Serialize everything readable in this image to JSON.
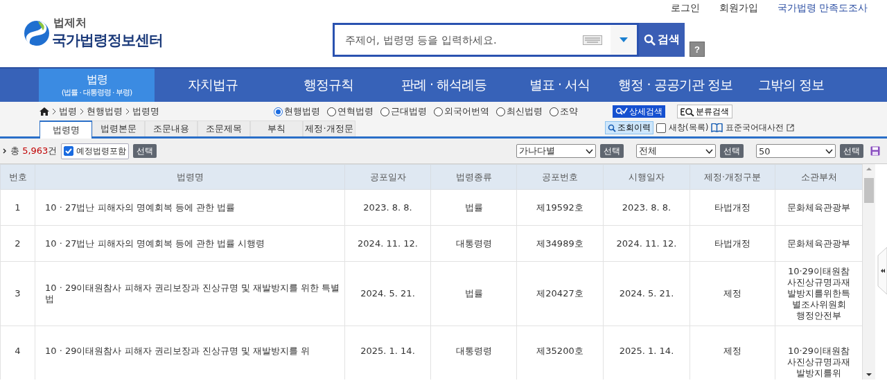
{
  "top_links": [
    {
      "label": "로그인",
      "kind": "plain"
    },
    {
      "label": "회원가입",
      "kind": "plain"
    },
    {
      "label": "국가법령 만족도조사",
      "kind": "accent"
    }
  ],
  "logo": {
    "agency": "법제처",
    "title": "국가법령정보센터"
  },
  "search": {
    "placeholder": "주제어, 법령명 등을 입력하세요.",
    "button": "검색",
    "help": "?"
  },
  "nav": [
    {
      "label": "법령",
      "sub": "(법률 · 대통령령 · 부령)",
      "selected": true
    },
    {
      "label": "자치법규",
      "selected": false
    },
    {
      "label": "행정규칙",
      "selected": false
    },
    {
      "label": "판례 · 해석례등",
      "selected": false
    },
    {
      "label": "별표 · 서식",
      "selected": false
    },
    {
      "label": "행정 · 공공기관 정보",
      "selected": false
    },
    {
      "label": "그밖의 정보",
      "selected": false
    }
  ],
  "breadcrumb": [
    "법령",
    "현행법령",
    "법령명"
  ],
  "scopes": [
    {
      "label": "현행법령",
      "selected": true
    },
    {
      "label": "연혁법령",
      "selected": false
    },
    {
      "label": "근대법령",
      "selected": false
    },
    {
      "label": "외국어번역",
      "selected": false
    },
    {
      "label": "최신법령",
      "selected": false
    },
    {
      "label": "조약",
      "selected": false
    }
  ],
  "detail_search": "상세검색",
  "category_search": "분류검색",
  "history": "조회이력",
  "new_window": {
    "label": "새창(목록)",
    "checked": false
  },
  "dictionary": "표준국어대사전",
  "tabs": [
    {
      "label": "법령명",
      "selected": true
    },
    {
      "label": "법령본문",
      "selected": false
    },
    {
      "label": "조문내용",
      "selected": false
    },
    {
      "label": "조문제목",
      "selected": false
    },
    {
      "label": "부칙",
      "selected": false
    },
    {
      "label": "제정·개정문",
      "selected": false
    }
  ],
  "toolbar": {
    "total_prefix": "총",
    "total": "5,963",
    "total_suffix": "건",
    "include_planned": {
      "label": "예정법령포함",
      "checked": true
    },
    "apply": "선택",
    "selects": [
      {
        "value": "가나다별",
        "button": "선택"
      },
      {
        "value": "전체",
        "button": "선택"
      },
      {
        "value": "50",
        "button": "선택"
      }
    ]
  },
  "table": {
    "columns": [
      "번호",
      "법령명",
      "공포일자",
      "법령종류",
      "공포번호",
      "시행일자",
      "제정·개정구분",
      "소관부처"
    ],
    "rows": [
      {
        "no": "1",
        "name": "10 · 27법난 피해자의 명예회복 등에 관한 법률",
        "promulgated": "2023. 8. 8.",
        "type": "법률",
        "number": "제19592호",
        "effective": "2023. 8. 8.",
        "revision": "타법개정",
        "ministry": [
          "문화체육관광부"
        ]
      },
      {
        "no": "2",
        "name": "10 · 27법난 피해자의 명예회복 등에 관한 법률 시행령",
        "promulgated": "2024. 11. 12.",
        "type": "대통령령",
        "number": "제34989호",
        "effective": "2024. 11. 12.",
        "revision": "타법개정",
        "ministry": [
          "문화체육관광부"
        ]
      },
      {
        "no": "3",
        "name": "10 · 29이태원참사 피해자 권리보장과 진상규명 및 재발방지를 위한 특별법",
        "promulgated": "2024. 5. 21.",
        "type": "법률",
        "number": "제20427호",
        "effective": "2024. 5. 21.",
        "revision": "제정",
        "ministry": [
          "10·29이태원참사진상규명과재발방지를위한특별조사위원회",
          "행정안전부"
        ]
      },
      {
        "no": "4",
        "name": "10 · 29이태원참사 피해자 권리보장과 진상규명 및 재발방지를 위",
        "promulgated": "2025. 1. 14.",
        "type": "대통령령",
        "number": "제35200호",
        "effective": "2025. 1. 14.",
        "revision": "제정",
        "ministry": [
          "10·29이태원참사진상규명과재발방지를위"
        ]
      }
    ]
  }
}
